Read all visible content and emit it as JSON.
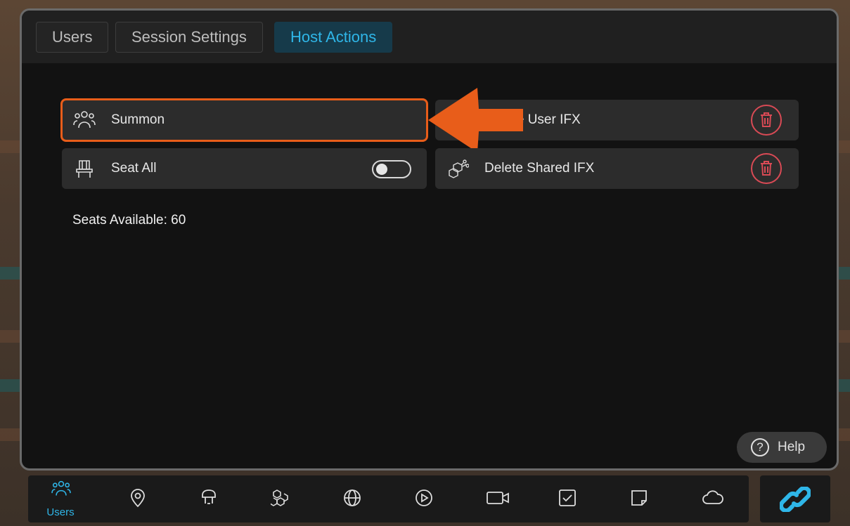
{
  "tabs": [
    {
      "label": "Users"
    },
    {
      "label": "Session Settings"
    },
    {
      "label": "Host Actions",
      "active": true
    }
  ],
  "actions": {
    "summon": "Summon",
    "delete_user_ifx": "ete User IFX",
    "seat_all": "Seat All",
    "seat_all_toggle": "off",
    "delete_shared_ifx": "Delete Shared IFX"
  },
  "seats_available": "Seats Available: 60",
  "help": {
    "label": "Help"
  },
  "toolbar": {
    "users_label": "Users",
    "icons": [
      "users-icon",
      "location-pin-icon",
      "avatar-icon",
      "objects-icon",
      "globe-icon",
      "play-icon",
      "video-camera-icon",
      "checkbox-icon",
      "sticky-note-icon",
      "cloud-icon",
      "link-icon"
    ]
  },
  "colors": {
    "accent": "#2fb6e8",
    "highlight": "#e85d1a",
    "danger": "#d94a55",
    "panel": "#121212"
  }
}
